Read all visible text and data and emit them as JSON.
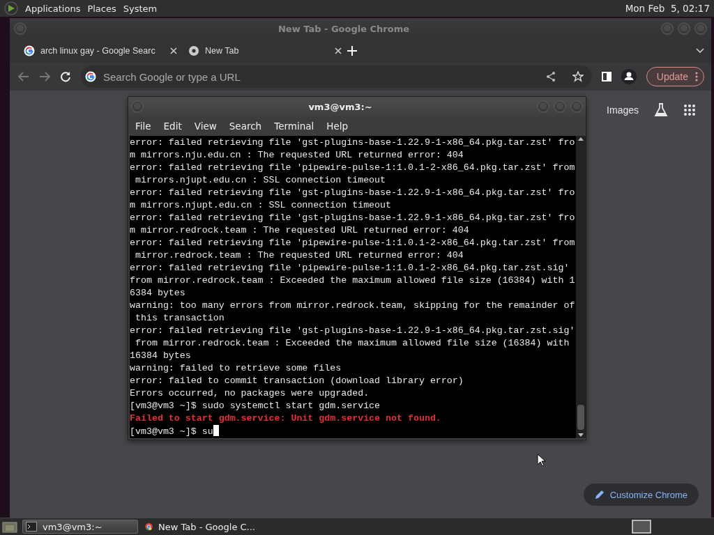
{
  "top_panel": {
    "menus": [
      "Applications",
      "Places",
      "System"
    ],
    "clock": "Mon Feb  5, 02:17"
  },
  "browser": {
    "window_title": "New Tab - Google Chrome",
    "tabs": [
      {
        "title": "arch linux gay - Google Searc"
      },
      {
        "title": "New Tab"
      }
    ],
    "address_bar": {
      "placeholder": "Search Google or type a URL"
    },
    "update_button": "Update",
    "page_links": [
      "Images"
    ],
    "customize_button": "Customize Chrome"
  },
  "terminal": {
    "title": "vm3@vm3:~",
    "menus": [
      "File",
      "Edit",
      "View",
      "Search",
      "Terminal",
      "Help"
    ],
    "lines": [
      {
        "kind": "output",
        "text": "error: failed retrieving file 'gst-plugins-base-1.22.9-1-x86_64.pkg.tar.zst' fro"
      },
      {
        "kind": "output",
        "text": "m mirrors.nju.edu.cn : The requested URL returned error: 404"
      },
      {
        "kind": "output",
        "text": "error: failed retrieving file 'pipewire-pulse-1:1.0.1-2-x86_64.pkg.tar.zst' from"
      },
      {
        "kind": "output",
        "text": " mirrors.njupt.edu.cn : SSL connection timeout"
      },
      {
        "kind": "output",
        "text": "error: failed retrieving file 'gst-plugins-base-1.22.9-1-x86_64.pkg.tar.zst' fro"
      },
      {
        "kind": "output",
        "text": "m mirrors.njupt.edu.cn : SSL connection timeout"
      },
      {
        "kind": "output",
        "text": "error: failed retrieving file 'gst-plugins-base-1.22.9-1-x86_64.pkg.tar.zst' fro"
      },
      {
        "kind": "output",
        "text": "m mirror.redrock.team : The requested URL returned error: 404"
      },
      {
        "kind": "output",
        "text": "error: failed retrieving file 'pipewire-pulse-1:1.0.1-2-x86_64.pkg.tar.zst' from"
      },
      {
        "kind": "output",
        "text": " mirror.redrock.team : The requested URL returned error: 404"
      },
      {
        "kind": "output",
        "text": "error: failed retrieving file 'pipewire-pulse-1:1.0.1-2-x86_64.pkg.tar.zst.sig'"
      },
      {
        "kind": "output",
        "text": "from mirror.redrock.team : Exceeded the maximum allowed file size (16384) with 1"
      },
      {
        "kind": "output",
        "text": "6384 bytes"
      },
      {
        "kind": "output",
        "text": "warning: too many errors from mirror.redrock.team, skipping for the remainder of"
      },
      {
        "kind": "output",
        "text": " this transaction"
      },
      {
        "kind": "output",
        "text": "error: failed retrieving file 'gst-plugins-base-1.22.9-1-x86_64.pkg.tar.zst.sig'"
      },
      {
        "kind": "output",
        "text": " from mirror.redrock.team : Exceeded the maximum allowed file size (16384) with"
      },
      {
        "kind": "output",
        "text": "16384 bytes"
      },
      {
        "kind": "output",
        "text": "warning: failed to retrieve some files"
      },
      {
        "kind": "output",
        "text": "error: failed to commit transaction (download library error)"
      },
      {
        "kind": "output",
        "text": "Errors occurred, no packages were upgraded."
      },
      {
        "kind": "output",
        "text": "[vm3@vm3 ~]$ sudo systemctl start gdm.service"
      },
      {
        "kind": "error",
        "text": "Failed to start gdm.service: Unit gdm.service not found."
      },
      {
        "kind": "prompt",
        "text": "[vm3@vm3 ~]$ su"
      }
    ]
  },
  "taskbar": {
    "items": [
      {
        "label": "vm3@vm3:~",
        "selected": true
      },
      {
        "label": "New Tab - Google C...",
        "selected": false
      }
    ]
  }
}
